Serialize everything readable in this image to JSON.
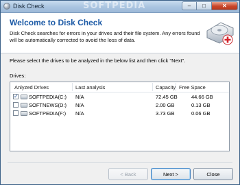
{
  "window": {
    "title": "Disk Check",
    "watermark": "SOFTPEDIA"
  },
  "header": {
    "heading": "Welcome to Disk Check",
    "description": "Disk Check searches for errors in your drives and their file system. Any errors found will be automatically corrected to avoid the loss of data."
  },
  "instruction": "Please select the drives to be analyzed in the below list and then click \"Next\".",
  "drives_label": "Drives:",
  "table": {
    "columns": [
      "Anlyzed Drives",
      "Last analysis",
      "Capacity",
      "Free Space"
    ],
    "rows": [
      {
        "checked": true,
        "drive": "SOFTPEDIA(C:)",
        "last_analysis": "N/A",
        "capacity": "72.45 GB",
        "free_space": "44.66 GB"
      },
      {
        "checked": false,
        "drive": "SOFTNEWS(D:)",
        "last_analysis": "N/A",
        "capacity": "2.00 GB",
        "free_space": "0.13 GB"
      },
      {
        "checked": false,
        "drive": "SOFTPEDIA(F:)",
        "last_analysis": "N/A",
        "capacity": "3.73 GB",
        "free_space": "0.06 GB"
      }
    ]
  },
  "buttons": {
    "back": "< Back",
    "next": "Next >",
    "close": "Close"
  },
  "colors": {
    "heading": "#1c5aa6",
    "close_button": "#c9452a"
  }
}
